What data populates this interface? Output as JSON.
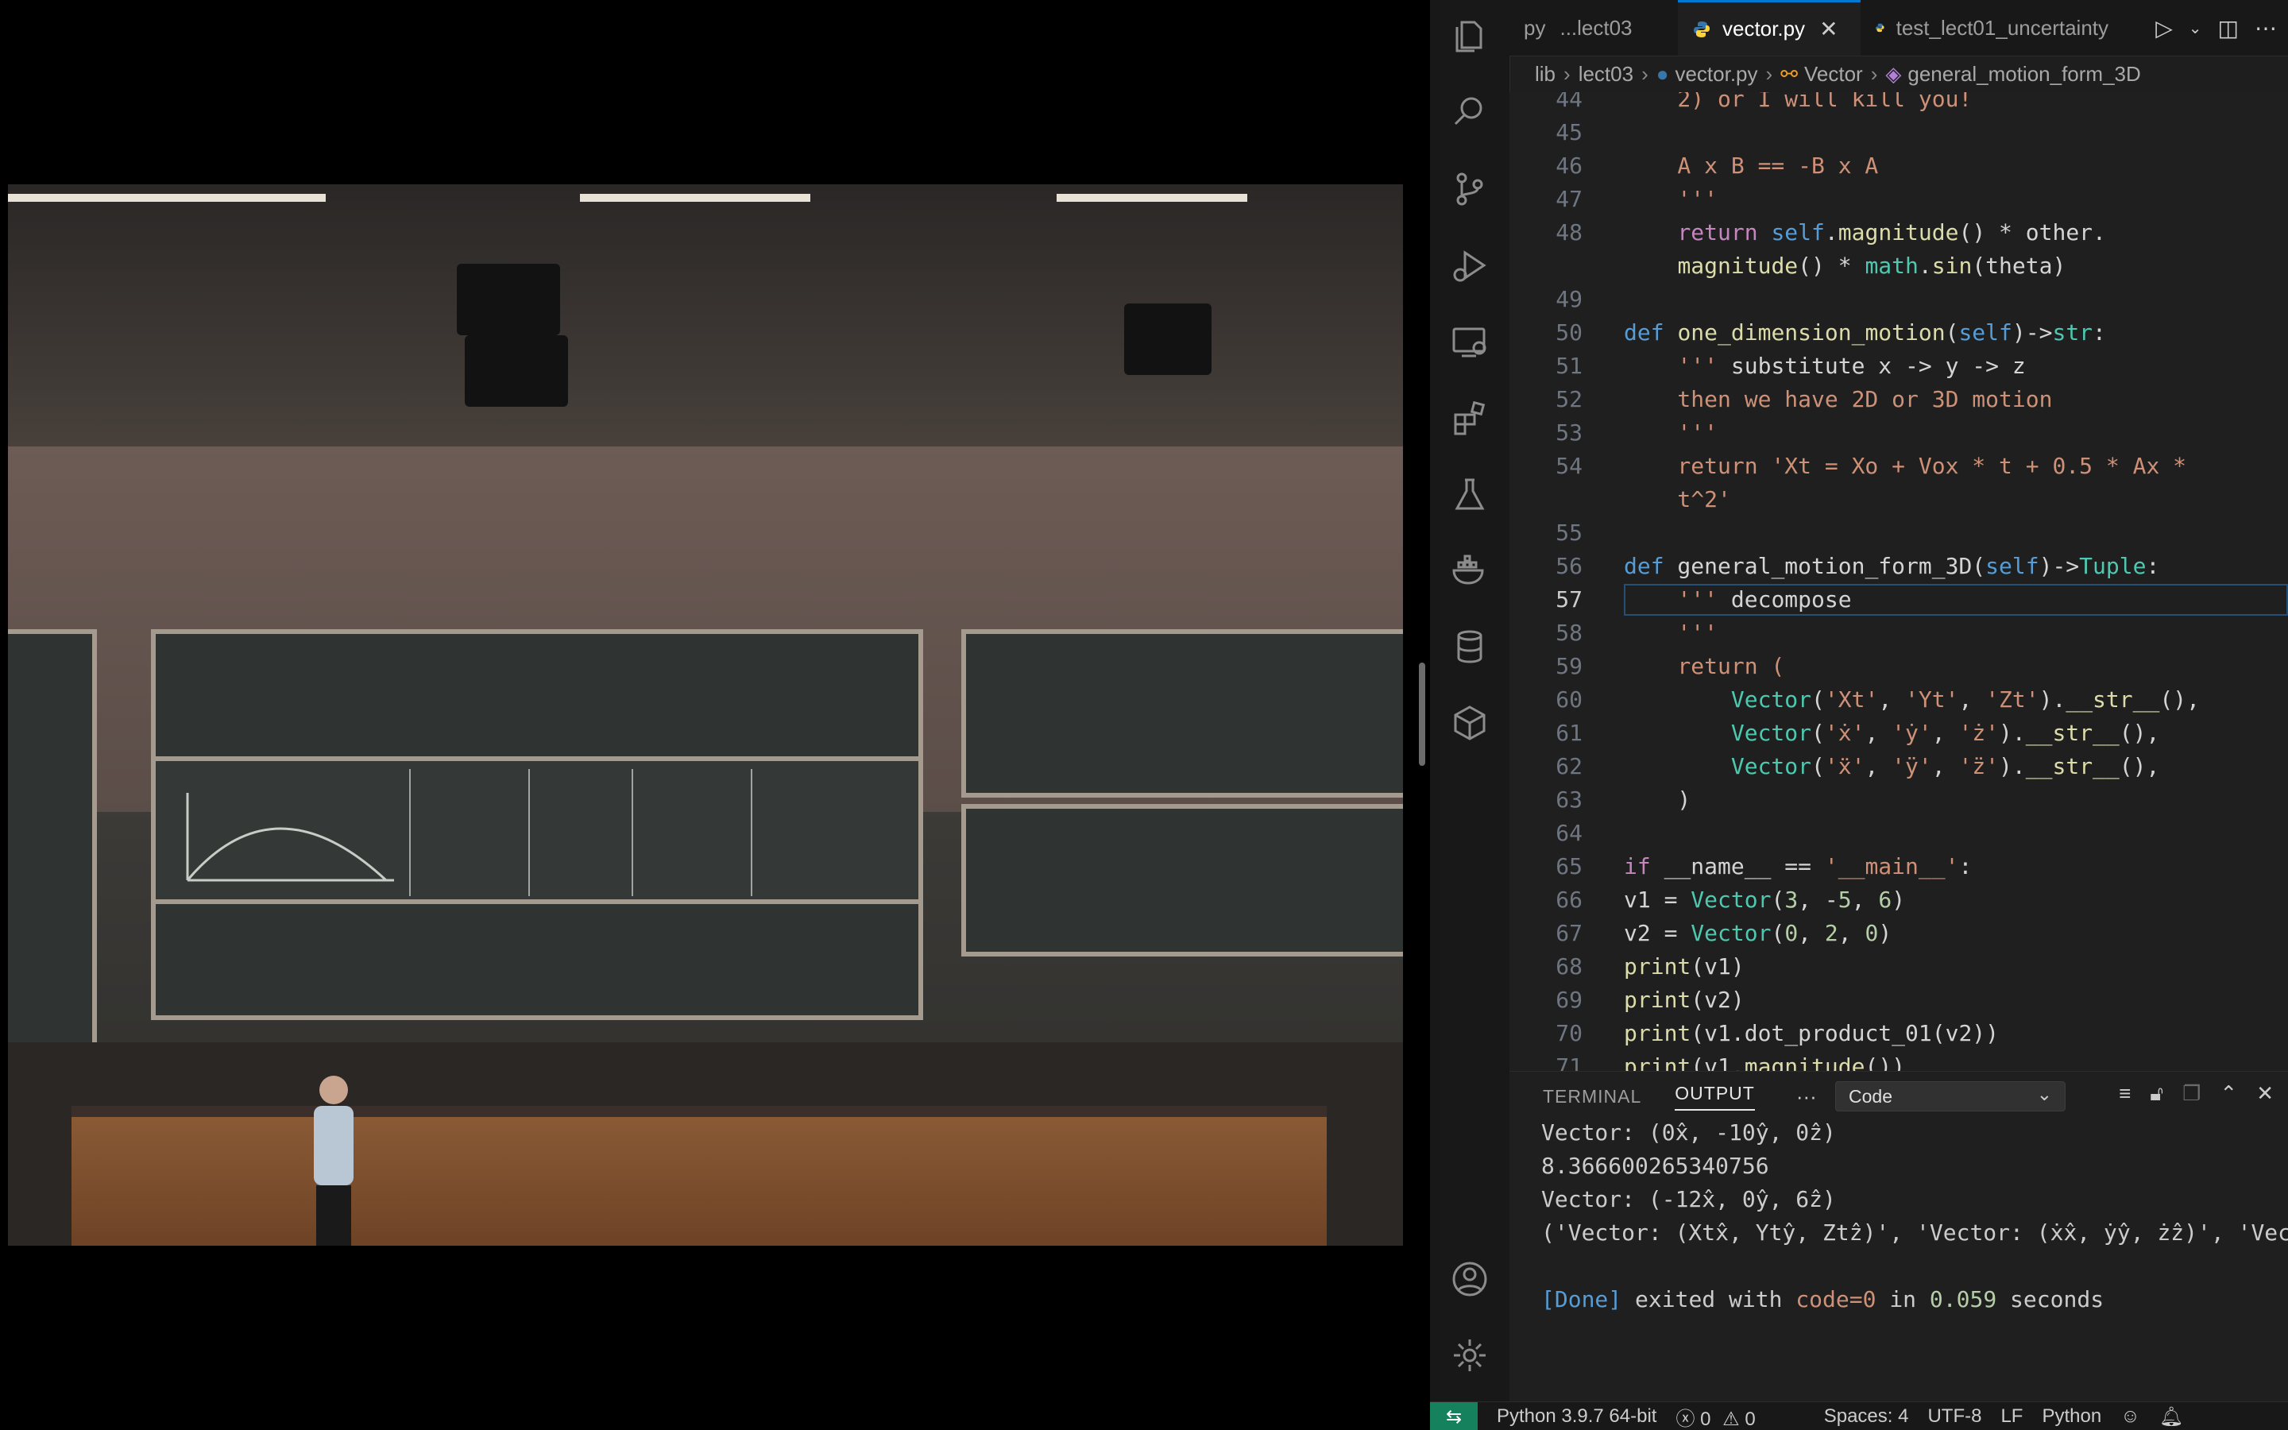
{
  "tabs": [
    {
      "label": "...lect03",
      "prefix": "py"
    },
    {
      "label": "vector.py",
      "active": true
    },
    {
      "label": "test_lect01_uncertainty"
    }
  ],
  "breadcrumb": [
    "lib",
    "lect03",
    "vector.py",
    "Vector",
    "general_motion_form_3D"
  ],
  "code_lines": [
    {
      "n": "44",
      "text": "        2) or I will kill you!"
    },
    {
      "n": "45",
      "text": ""
    },
    {
      "n": "46",
      "text": "        A x B == -B x A"
    },
    {
      "n": "47",
      "text": "        '''"
    },
    {
      "n": "48",
      "text": "        return self.magnitude() * other."
    },
    {
      "n": "",
      "text": "        magnitude() * math.sin(theta)"
    },
    {
      "n": "49",
      "text": ""
    },
    {
      "n": "50",
      "text": "    def one_dimension_motion(self)->str:"
    },
    {
      "n": "51",
      "text": "        ''' substitute x -> y -> z"
    },
    {
      "n": "52",
      "text": "        then we have 2D or 3D motion"
    },
    {
      "n": "53",
      "text": "        '''"
    },
    {
      "n": "54",
      "text": "        return 'Xt = Xo + Vox * t + 0.5 * Ax *"
    },
    {
      "n": "",
      "text": "        t^2'"
    },
    {
      "n": "55",
      "text": ""
    },
    {
      "n": "56",
      "text": "    def general_motion_form_3D(self)->Tuple:"
    },
    {
      "n": "57",
      "text": "        ''' decompose"
    },
    {
      "n": "58",
      "text": "        '''"
    },
    {
      "n": "59",
      "text": "        return ("
    },
    {
      "n": "60",
      "text": "            Vector('Xt', 'Yt', 'Zt').__str__(),"
    },
    {
      "n": "61",
      "text": "            Vector('ẋ', 'ẏ', 'ż').__str__(),"
    },
    {
      "n": "62",
      "text": "            Vector('ẍ', 'ÿ', 'z̈').__str__(),"
    },
    {
      "n": "63",
      "text": "        )"
    },
    {
      "n": "64",
      "text": ""
    },
    {
      "n": "65",
      "text": "if __name__ == '__main__':"
    },
    {
      "n": "66",
      "text": "    v1 = Vector(3, -5, 6)"
    },
    {
      "n": "67",
      "text": "    v2 = Vector(0, 2, 0)"
    },
    {
      "n": "68",
      "text": "    print(v1)"
    },
    {
      "n": "69",
      "text": "    print(v2)"
    },
    {
      "n": "70",
      "text": "    print(v1.dot_product_01(v2))"
    },
    {
      "n": "71",
      "text": "    print(v1.magnitude())"
    }
  ],
  "panel": {
    "tabs": [
      "TERMINAL",
      "OUTPUT",
      "···"
    ],
    "active_tab": "OUTPUT",
    "select_value": "Code",
    "output_lines": [
      "Vector: (0x̂, -10ŷ, 0ẑ)",
      "8.366600265340756",
      "Vector: (-12x̂, 0ŷ, 6ẑ)",
      "('Vector: (Xtx̂, Ytŷ, Ztẑ)', 'Vector: (ẋx̂, ẏŷ, żẑ)', 'Vec",
      "",
      "[Done] exited with code=0 in 0.059 seconds"
    ]
  },
  "status": {
    "interpreter": "Python 3.9.7 64-bit",
    "errors": "0",
    "warnings": "0",
    "spaces": "Spaces: 4",
    "encoding": "UTF-8",
    "eol": "LF",
    "language": "Python"
  },
  "colors": {
    "accent": "#0078d4",
    "remote": "#16825d",
    "editor_bg": "#1f1f1f"
  }
}
